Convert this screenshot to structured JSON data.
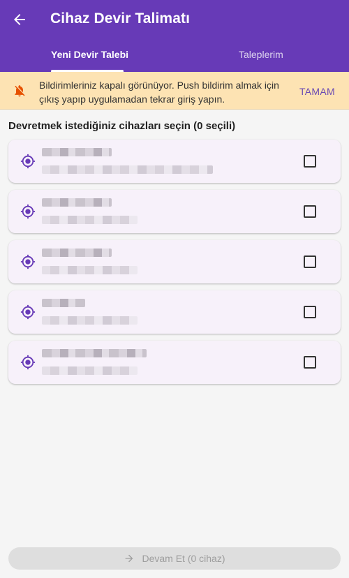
{
  "appbar": {
    "title": "Cihaz Devir Talimatı",
    "back_icon": "arrow-back-icon"
  },
  "tabs": [
    {
      "label": "Yeni Devir Talebi",
      "active": true
    },
    {
      "label": "Taleplerim",
      "active": false
    }
  ],
  "banner": {
    "icon": "notifications-off-icon",
    "message": "Bildirimleriniz kapalı görünüyor. Push bildirim almak için çıkış yapıp uygulamadan tekrar giriş yapın.",
    "action_label": "TAMAM"
  },
  "section": {
    "title": "Devretmek istediğiniz cihazları seçin (0 seçili)"
  },
  "devices": [
    {
      "name": "",
      "detail": "",
      "icon": "gps-location-icon",
      "checked": false
    },
    {
      "name": "",
      "detail": "",
      "icon": "gps-location-icon",
      "checked": false
    },
    {
      "name": "",
      "detail": "",
      "icon": "gps-location-icon",
      "checked": false
    },
    {
      "name": "",
      "detail": "",
      "icon": "gps-location-icon",
      "checked": false
    },
    {
      "name": "",
      "detail": "",
      "icon": "gps-location-icon",
      "checked": false
    }
  ],
  "footer": {
    "continue_label": "Devam Et (0 cihaz)",
    "enabled": false
  },
  "colors": {
    "primary": "#673ab7",
    "banner_bg": "#fde3b3",
    "banner_icon": "#e65100",
    "card_bg": "#f7f1fa",
    "disabled_button": "#dedede"
  }
}
